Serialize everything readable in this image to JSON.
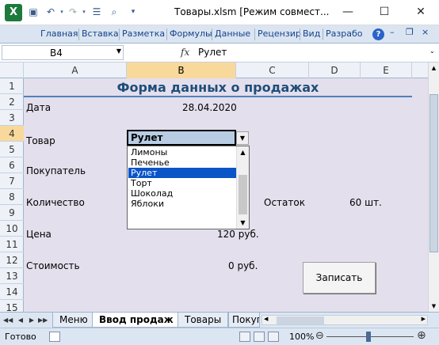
{
  "window": {
    "title": "Товары.xlsm  [Режим совмест...",
    "app_logo": "X",
    "minimize": "—",
    "maximize": "☐",
    "close": "✕"
  },
  "ribbon": {
    "tabs": [
      "Главная",
      "Вставка",
      "Разметка",
      "Формулы",
      "Данные",
      "Рецензир",
      "Вид",
      "Разрабо"
    ],
    "help": "?"
  },
  "formula_bar": {
    "name_box": "B4",
    "fx": "fx",
    "value": "Рулет"
  },
  "columns": [
    "A",
    "B",
    "C",
    "D",
    "E"
  ],
  "rows": [
    "1",
    "2",
    "3",
    "4",
    "5",
    "6",
    "7",
    "8",
    "9",
    "10",
    "11",
    "12",
    "13",
    "14",
    "15"
  ],
  "sheet": {
    "title": "Форма данных о продажах",
    "labels": {
      "date": "Дата",
      "product": "Товар",
      "buyer": "Покупатель",
      "quantity": "Количество",
      "stock": "Остаток",
      "price": "Цена",
      "cost": "Стоимость"
    },
    "values": {
      "date": "28.04.2020",
      "stock": "60 шт.",
      "price": "120 руб.",
      "cost": "0 руб."
    },
    "combo_value": "Рулет",
    "dropdown_items": [
      "Лимоны",
      "Печенье",
      "Рулет",
      "Торт",
      "Шоколад",
      "Яблоки"
    ],
    "selected_index": 2,
    "save_button": "Записать"
  },
  "sheet_tabs": [
    "Меню",
    "Ввод продаж",
    "Товары",
    "Покуп"
  ],
  "active_sheet_tab": "Ввод продаж",
  "status": {
    "ready": "Готово",
    "zoom": "100%"
  },
  "colors": {
    "grid_bg": "#e4dfec",
    "title_color": "#1f4e79",
    "selection": "#0a54c8",
    "combo_bg": "#b8cce4"
  }
}
